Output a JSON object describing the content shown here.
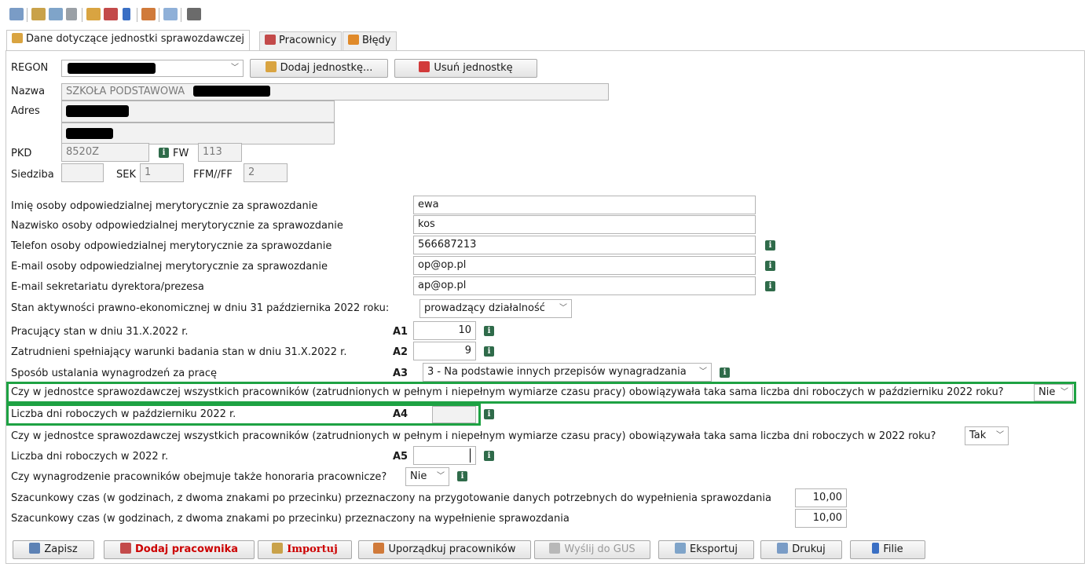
{
  "toolbar": {
    "icons": [
      "print-icon",
      "import-icon",
      "export-icon",
      "send-icon",
      "add-unit-icon",
      "add-employee-icon",
      "branches-icon",
      "sort-icon",
      "clear-icon",
      "table-icon"
    ]
  },
  "tabs": [
    {
      "label": "Dane dotyczące jednostki sprawozdawczej",
      "icon": "house-icon"
    },
    {
      "label": "Pracownicy",
      "icon": "people-icon"
    },
    {
      "label": "Błędy",
      "icon": "error-icon"
    }
  ],
  "unit": {
    "regon_label": "REGON",
    "add_unit_label": "Dodaj jednostkę...",
    "remove_unit_label": "Usuń jednostkę",
    "nazwa_label": "Nazwa",
    "nazwa_value": "SZKOŁA PODSTAWOWA",
    "adres_label": "Adres",
    "pkd_label": "PKD",
    "pkd_value": "8520Z",
    "fw_label": "FW",
    "fw_value": "113",
    "siedziba_label": "Siedziba",
    "sek_label": "SEK",
    "sek_value": "1",
    "ffm_label": "FFM//FF",
    "ffm_value": "2"
  },
  "form": {
    "imie_label": "Imię osoby odpowiedzialnej merytorycznie za sprawozdanie",
    "imie_value": "ewa",
    "nazwisko_label": "Nazwisko osoby odpowiedzialnej merytorycznie za sprawozdanie",
    "nazwisko_value": "kos",
    "telefon_label": "Telefon osoby odpowiedzialnej merytorycznie za sprawozdanie",
    "telefon_value": "566687213",
    "email_label": "E-mail osoby odpowiedzialnej merytorycznie za sprawozdanie",
    "email_value": "op@op.pl",
    "email_sekr_label": "E-mail sekretariatu dyrektora/prezesa",
    "email_sekr_value": "ap@op.pl",
    "stan_label": "Stan aktywności prawno-ekonomicznej w dniu 31 października 2022 roku:",
    "stan_value": "prowadzący działalność",
    "a1_label": "Pracujący stan w dniu 31.X.2022 r.",
    "a1_code": "A1",
    "a1_value": "10",
    "a2_label": "Zatrudnieni spełniający warunki badania stan w dniu 31.X.2022 r.",
    "a2_code": "A2",
    "a2_value": "9",
    "a3_label": "Sposób ustalania wynagrodzeń za pracę",
    "a3_code": "A3",
    "a3_value": "3 - Na podstawie innych przepisów wynagradzania",
    "q_oct_label": "Czy w jednostce sprawozdawczej wszystkich pracowników (zatrudnionych w pełnym i niepełnym wymiarze czasu pracy) obowiązywała taka sama liczba dni roboczych w październiku 2022 roku?",
    "q_oct_value": "Nie",
    "a4_label": "Liczba dni roboczych w październiku 2022 r.",
    "a4_code": "A4",
    "a4_value": "",
    "q_year_label": "Czy w jednostce sprawozdawczej wszystkich pracowników (zatrudnionych w pełnym i niepełnym wymiarze czasu pracy) obowiązywała taka sama liczba dni roboczych w 2022 roku?",
    "q_year_value": "Tak",
    "a5_label": "Liczba dni roboczych w 2022 r.",
    "a5_code": "A5",
    "a5_value": "",
    "hon_label": "Czy wynagrodzenie pracowników obejmuje także honoraria pracownicze?",
    "hon_value": "Nie",
    "czas1_label": "Szacunkowy czas (w godzinach, z dwoma znakami po przecinku) przeznaczony na przygotowanie danych potrzebnych do wypełnienia sprawozdania",
    "czas1_value": "10,00",
    "czas2_label": "Szacunkowy czas (w godzinach, z dwoma znakami po przecinku) przeznaczony na wypełnienie sprawozdania",
    "czas2_value": "10,00"
  },
  "buttons": {
    "zapisz": "Zapisz",
    "dodaj_pracownika": "Dodaj pracownika",
    "importuj": "Importuj",
    "uporzadkuj": "Uporządkuj pracowników",
    "wyslij": "Wyślij do GUS",
    "eksportuj": "Eksportuj",
    "drukuj": "Drukuj",
    "filie": "Filie"
  },
  "colors": {
    "highlight": "#1ea243",
    "info_icon": "#2f6b4a",
    "accent_red": "#cc0000"
  }
}
